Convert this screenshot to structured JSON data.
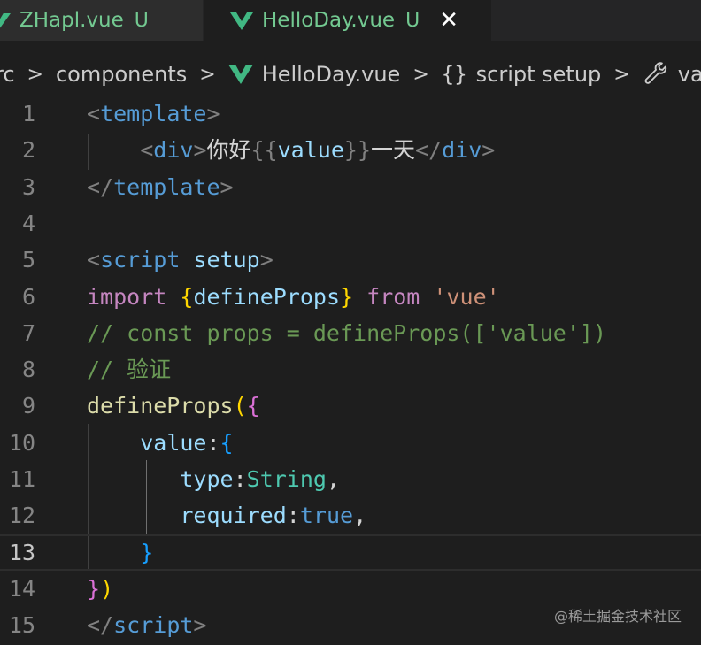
{
  "tabs": [
    {
      "name": "ZHapl.vue",
      "status": "U",
      "active": false
    },
    {
      "name": "HelloDay.vue",
      "status": "U",
      "active": true,
      "close": "✕"
    }
  ],
  "breadcrumb": {
    "segments": [
      "rc",
      "components",
      "HelloDay.vue",
      "script setup",
      "val"
    ],
    "separator": ">",
    "braces": "{}"
  },
  "editor": {
    "current_line": 13,
    "lines": [
      {
        "n": "1",
        "tokens": [
          [
            "punc",
            "<"
          ],
          [
            "tag",
            "template"
          ],
          [
            "punc",
            ">"
          ]
        ]
      },
      {
        "n": "2",
        "tokens": [
          [
            "text",
            "    "
          ],
          [
            "punc",
            "<"
          ],
          [
            "tag",
            "div"
          ],
          [
            "punc",
            ">"
          ],
          [
            "text",
            "你好"
          ],
          [
            "punc",
            "{{"
          ],
          [
            "attr",
            "value"
          ],
          [
            "punc",
            "}}"
          ],
          [
            "text",
            "一天"
          ],
          [
            "punc",
            "</"
          ],
          [
            "tag",
            "div"
          ],
          [
            "punc",
            ">"
          ]
        ]
      },
      {
        "n": "3",
        "tokens": [
          [
            "punc",
            "</"
          ],
          [
            "tag",
            "template"
          ],
          [
            "punc",
            ">"
          ]
        ]
      },
      {
        "n": "4",
        "tokens": []
      },
      {
        "n": "5",
        "tokens": [
          [
            "punc",
            "<"
          ],
          [
            "tag",
            "script"
          ],
          [
            "text",
            " "
          ],
          [
            "attr",
            "setup"
          ],
          [
            "punc",
            ">"
          ]
        ]
      },
      {
        "n": "6",
        "tokens": [
          [
            "kw",
            "import"
          ],
          [
            "text",
            " "
          ],
          [
            "br1",
            "{"
          ],
          [
            "attr",
            "defineProps"
          ],
          [
            "br1",
            "}"
          ],
          [
            "text",
            " "
          ],
          [
            "kw",
            "from"
          ],
          [
            "text",
            " "
          ],
          [
            "str",
            "'vue'"
          ]
        ]
      },
      {
        "n": "7",
        "tokens": [
          [
            "com",
            "// const props = defineProps(['value'])"
          ]
        ]
      },
      {
        "n": "8",
        "tokens": [
          [
            "com",
            "// 验证"
          ]
        ]
      },
      {
        "n": "9",
        "tokens": [
          [
            "fn",
            "defineProps"
          ],
          [
            "br1",
            "("
          ],
          [
            "br2",
            "{"
          ]
        ]
      },
      {
        "n": "10",
        "tokens": [
          [
            "text",
            "    "
          ],
          [
            "prop",
            "value"
          ],
          [
            "text",
            ":"
          ],
          [
            "br3",
            "{"
          ]
        ]
      },
      {
        "n": "11",
        "tokens": [
          [
            "text",
            "       "
          ],
          [
            "prop",
            "type"
          ],
          [
            "text",
            ":"
          ],
          [
            "type",
            "String"
          ],
          [
            "text",
            ","
          ]
        ]
      },
      {
        "n": "12",
        "tokens": [
          [
            "text",
            "       "
          ],
          [
            "prop",
            "required"
          ],
          [
            "text",
            ":"
          ],
          [
            "bool",
            "true"
          ],
          [
            "text",
            ","
          ]
        ]
      },
      {
        "n": "13",
        "tokens": [
          [
            "text",
            "    "
          ],
          [
            "br3",
            "}"
          ]
        ]
      },
      {
        "n": "14",
        "tokens": [
          [
            "br2",
            "}"
          ],
          [
            "br1",
            ")"
          ]
        ]
      },
      {
        "n": "15",
        "tokens": [
          [
            "punc",
            "</"
          ],
          [
            "tag",
            "script"
          ],
          [
            "punc",
            ">"
          ]
        ]
      }
    ]
  },
  "watermark": "@稀土掘金技术社区",
  "colors": {
    "background": "#1e1e1e",
    "tab_bar": "#252526",
    "vue_green": "#41b883",
    "untracked": "#73c991"
  }
}
